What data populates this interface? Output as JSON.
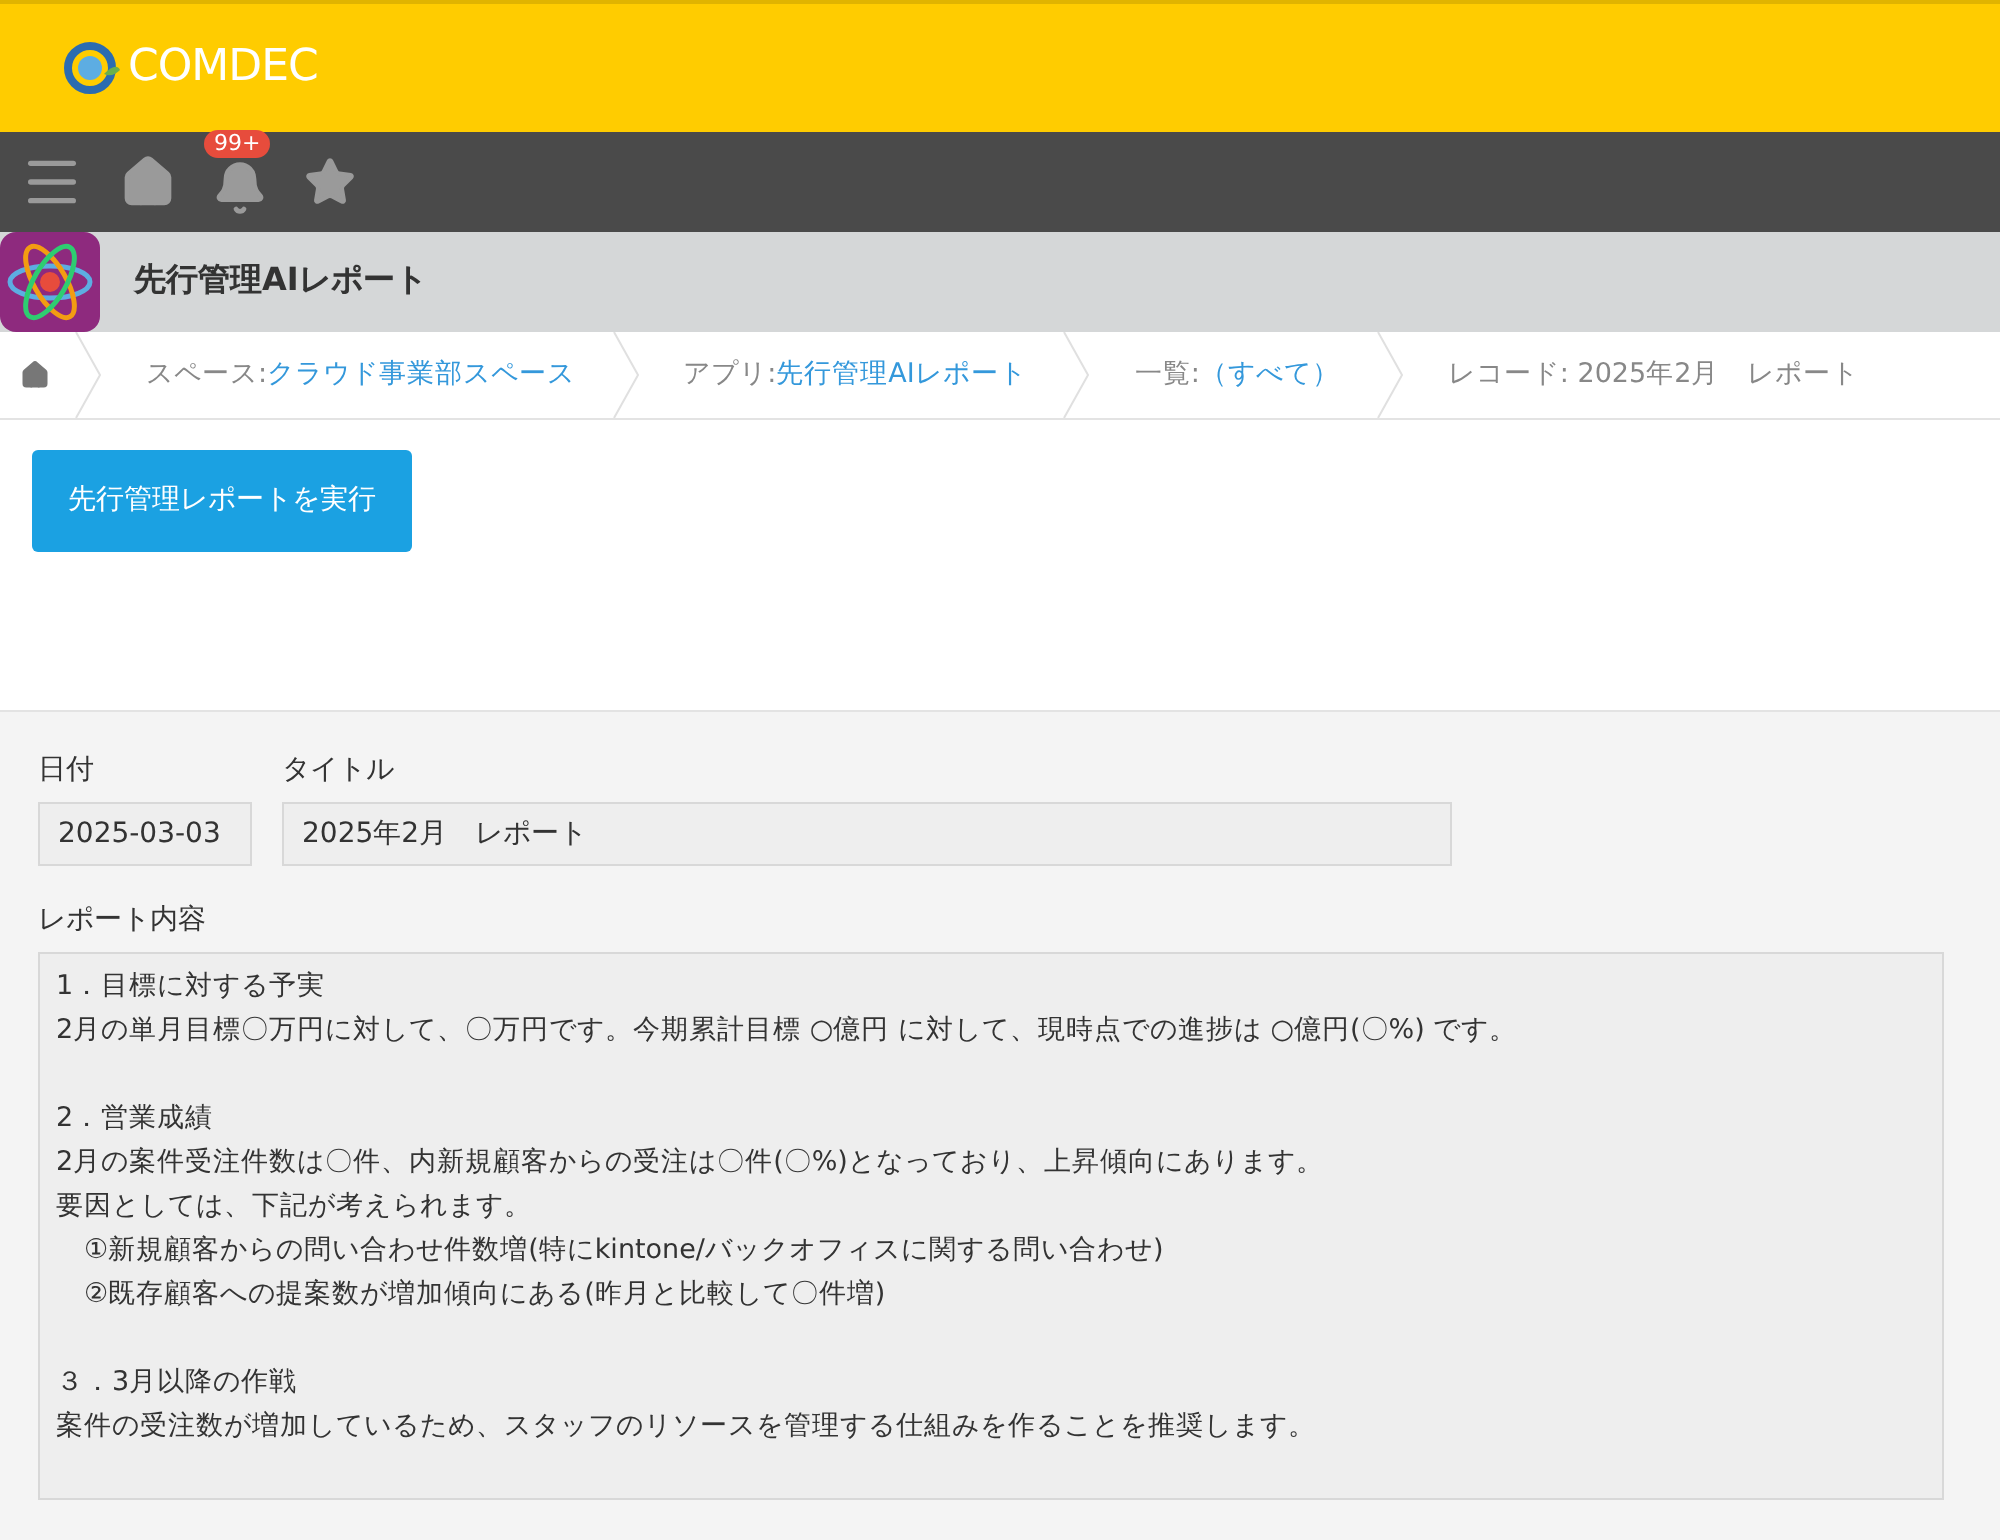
{
  "header": {
    "logo_text": "COMDEC"
  },
  "nav": {
    "notification_badge": "99+"
  },
  "app": {
    "title": "先行管理AIレポート"
  },
  "breadcrumb": [
    {
      "label": "スペース: ",
      "link": "クラウド事業部スペース"
    },
    {
      "label": "アプリ: ",
      "link": "先行管理AIレポート"
    },
    {
      "label": "一覧: ",
      "link": "（すべて）"
    },
    {
      "label": "レコード: 2025年2月　レポート"
    }
  ],
  "action_button": "先行管理レポートを実行",
  "record": {
    "date": {
      "label": "日付",
      "value": "2025-03-03"
    },
    "title": {
      "label": "タイトル",
      "value": "2025年2月　レポート"
    },
    "report": {
      "label": "レポート内容",
      "sections": [
        [
          "1．目標に対する予実",
          "2月の単月目標〇万円に対して、〇万円です。今期累計目標 ○億円 に対して、現時点での進捗は ○億円(〇%) です。"
        ],
        [
          "2．営業成績",
          "2月の案件受注件数は〇件、内新規顧客からの受注は〇件(〇%)となっており、上昇傾向にあります。",
          "要因としては、下記が考えられます。",
          "　①新規顧客からの問い合わせ件数増(特にkintone/バックオフィスに関する問い合わせ)",
          "　②既存顧客への提案数が増加傾向にある(昨月と比較して〇件増)"
        ],
        [
          "３．3月以降の作戦",
          "案件の受注数が増加しているため、スタッフのリソースを管理する仕組みを作ることを推奨します。"
        ]
      ]
    }
  }
}
